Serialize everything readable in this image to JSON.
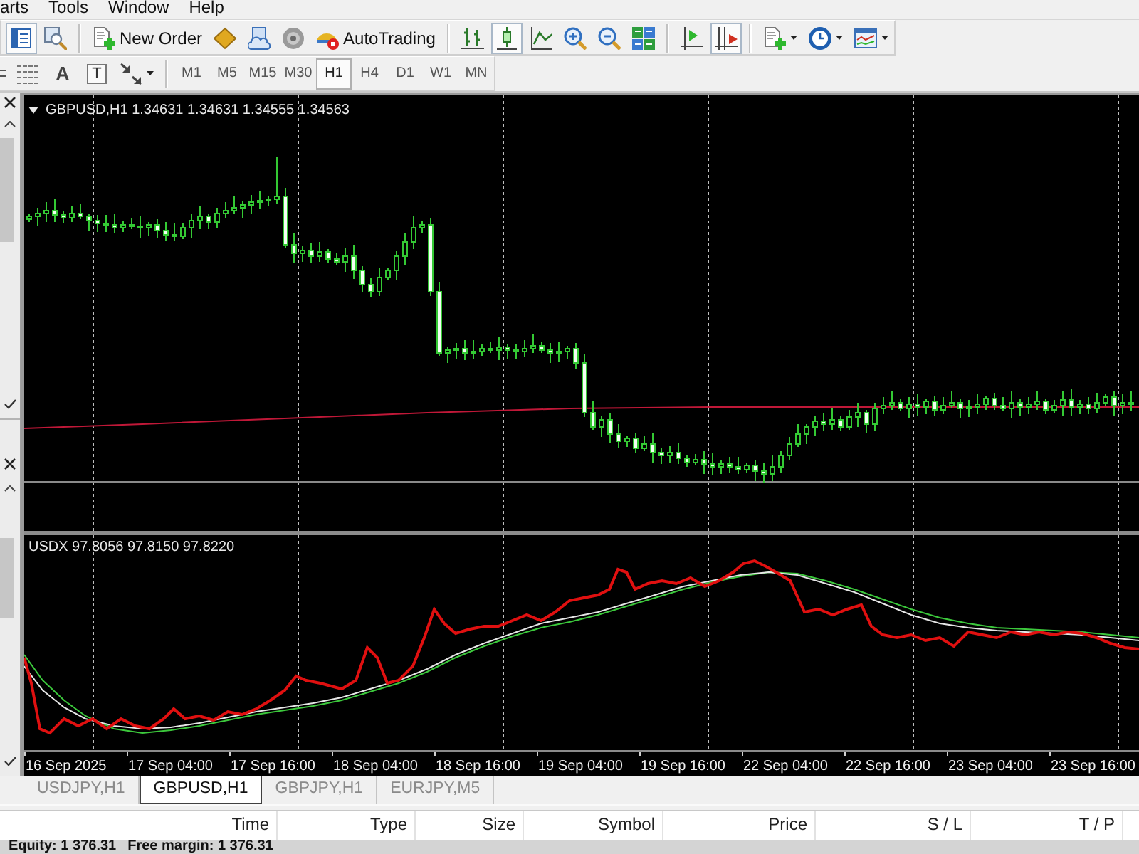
{
  "menu_bar": {
    "items": [
      "arts",
      "Tools",
      "Window",
      "Help"
    ]
  },
  "toolbar": {
    "view_toggle": {
      "on": true
    },
    "new_order": "New Order",
    "auto_trading": "AutoTrading",
    "chart_modes": [
      {
        "selected": false
      },
      {
        "selected": true
      },
      {
        "selected": false
      }
    ],
    "auto_scroll": {
      "on": true
    }
  },
  "drawing_toolbar": {
    "text_tool": "A",
    "label_tool": "T"
  },
  "timeframes": [
    {
      "label": "M1",
      "selected": false
    },
    {
      "label": "M5",
      "selected": false
    },
    {
      "label": "M15",
      "selected": false
    },
    {
      "label": "M30",
      "selected": false
    },
    {
      "label": "H1",
      "selected": true
    },
    {
      "label": "H4",
      "selected": false
    },
    {
      "label": "D1",
      "selected": false
    },
    {
      "label": "W1",
      "selected": false
    },
    {
      "label": "MN",
      "selected": false
    }
  ],
  "chart": {
    "title": "GBPUSD,H1 1.34631 1.34631 1.34555 1.34563",
    "indicator_title": "USDX 97.8056 97.8150 97.8220",
    "time_labels": [
      "16 Sep 2025",
      "17 Sep 04:00",
      "17 Sep 16:00",
      "18 Sep 04:00",
      "18 Sep 16:00",
      "19 Sep 04:00",
      "19 Sep 16:00",
      "22 Sep 04:00",
      "22 Sep 16:00",
      "23 Sep 04:00",
      "23 Sep 16:00"
    ]
  },
  "chart_tabs": [
    {
      "label": "USDJPY,H1",
      "selected": false
    },
    {
      "label": "GBPUSD,H1",
      "selected": true
    },
    {
      "label": "GBPJPY,H1",
      "selected": false
    },
    {
      "label": "EURJPY,M5",
      "selected": false
    }
  ],
  "table": {
    "columns": [
      "Time",
      "Type",
      "Size",
      "Symbol",
      "Price",
      "S / L",
      "T / P"
    ]
  },
  "status_bar": {
    "equity": "Equity: 1 376.31",
    "free_margin": "Free margin: 1 376.31"
  }
}
